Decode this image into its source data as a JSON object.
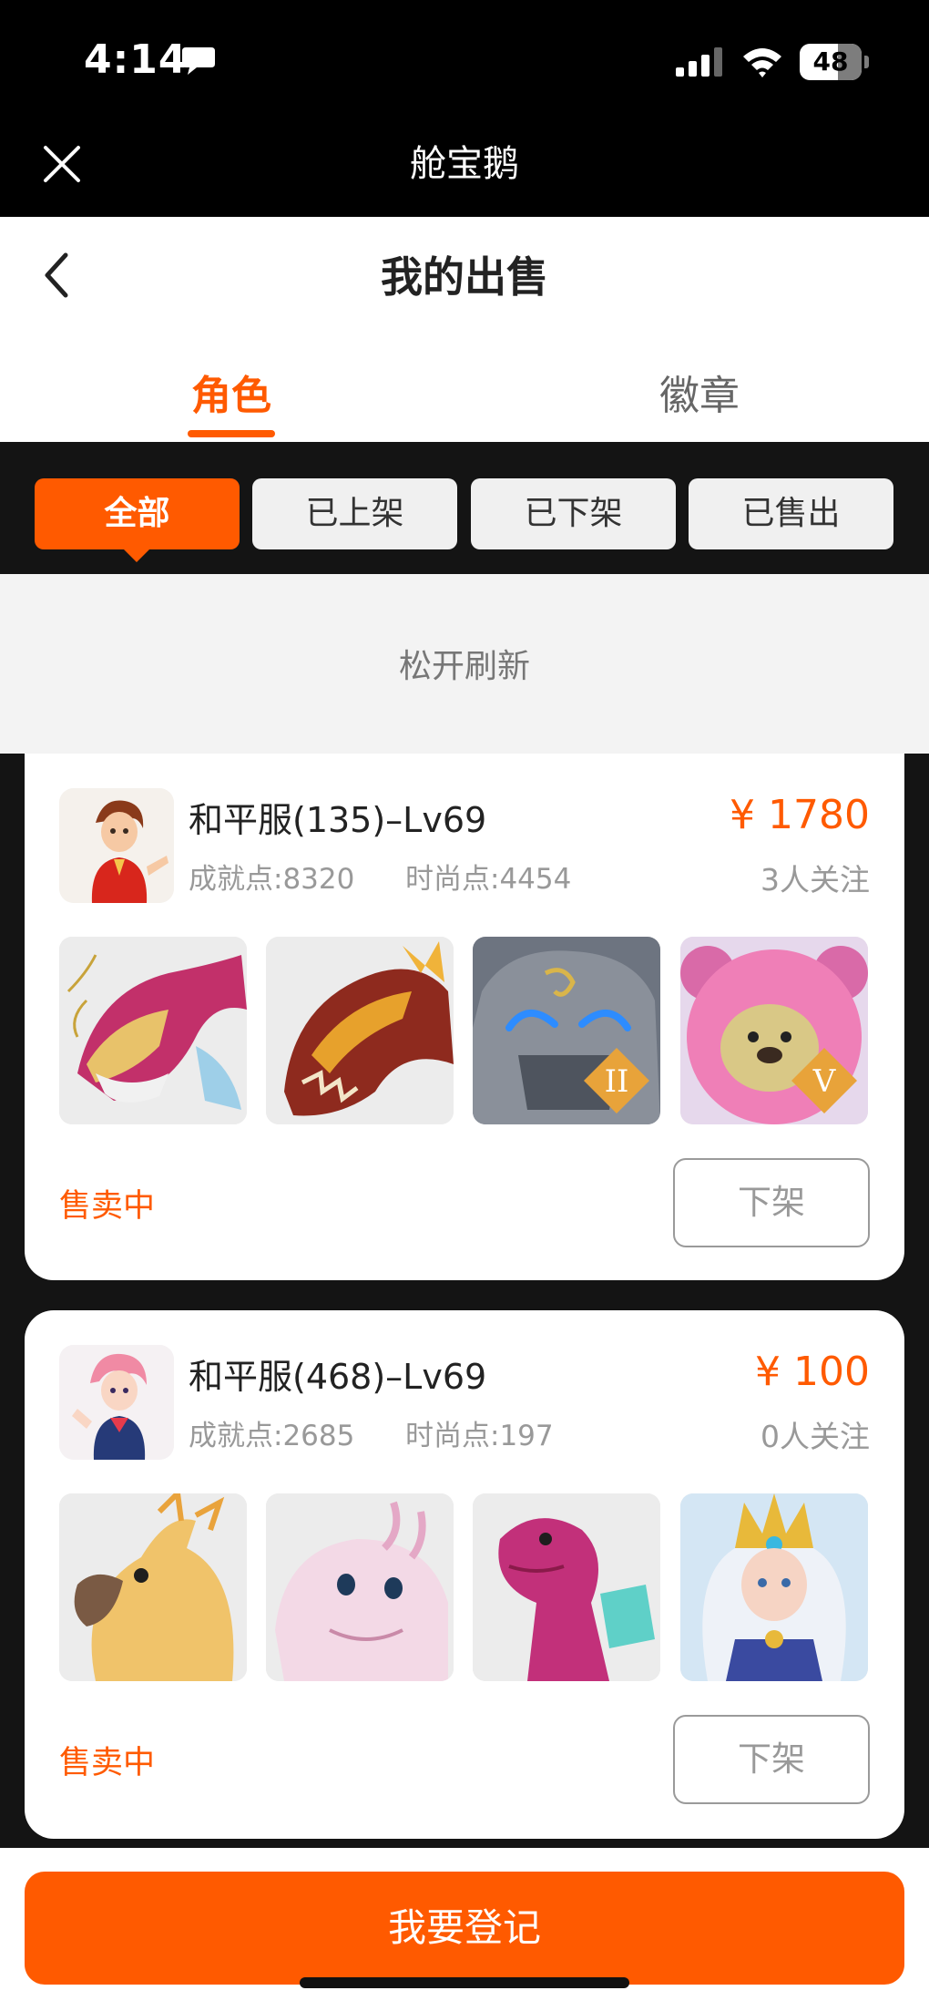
{
  "status_bar": {
    "time": "4:14",
    "battery": "48"
  },
  "app_header": {
    "title": "舱宝鹅"
  },
  "nav": {
    "title": "我的出售"
  },
  "tabs": [
    {
      "label": "角色"
    },
    {
      "label": "徽章"
    }
  ],
  "filters": [
    {
      "label": "全部"
    },
    {
      "label": "已上架"
    },
    {
      "label": "已下架"
    },
    {
      "label": "已售出"
    }
  ],
  "refresh_text": "松开刷新",
  "listings": [
    {
      "name": "和平服(135)–Lv69",
      "achievement": "成就点:8320",
      "fashion": "时尚点:4454",
      "price": "¥ 1780",
      "follows": "3人关注",
      "skin_badges": [
        "",
        "",
        "II",
        "V"
      ],
      "status": "售卖中",
      "action": "下架"
    },
    {
      "name": "和平服(468)–Lv69",
      "achievement": "成就点:2685",
      "fashion": "时尚点:197",
      "price": "¥ 100",
      "follows": "0人关注",
      "skin_badges": [
        "",
        "",
        "",
        ""
      ],
      "status": "售卖中",
      "action": "下架"
    }
  ],
  "bottom": {
    "register_label": "我要登记"
  },
  "colors": {
    "accent": "#ff5a00",
    "dark_bg": "#141414",
    "header_bg": "#000000"
  },
  "icons": [
    "message-icon",
    "signal-icon",
    "wifi-icon",
    "close-icon",
    "back-icon"
  ]
}
